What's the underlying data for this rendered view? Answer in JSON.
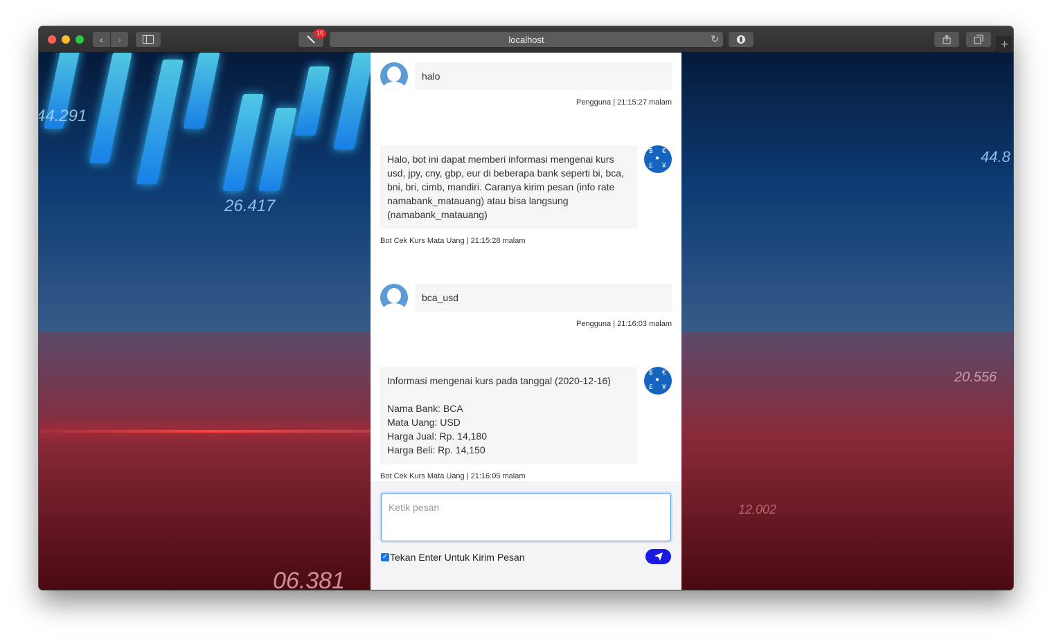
{
  "browser": {
    "address": "localhost",
    "extension_badge": "15",
    "icons": {
      "back": "chevron-left-icon",
      "forward": "chevron-right-icon",
      "sidebar": "sidebar-icon",
      "reload": "reload-icon",
      "share": "share-icon",
      "tabs": "tabs-icon",
      "new_tab": "plus-icon"
    }
  },
  "background": {
    "numbers": [
      "44.291",
      "26.417",
      "06.381",
      "44.8",
      "20.556",
      "12.002"
    ]
  },
  "chat": {
    "messages": [
      {
        "sender": "user",
        "text": "halo",
        "meta": "Pengguna | 21:15:27 malam"
      },
      {
        "sender": "bot",
        "text": "Halo, bot ini dapat memberi informasi mengenai kurs usd, jpy, cny, gbp, eur di beberapa bank seperti bi, bca, bni, bri, cimb, mandiri. Caranya kirim pesan (info rate namabank_matauang) atau bisa langsung (namabank_matauang)",
        "meta": "Bot Cek Kurs Mata Uang | 21:15:28 malam"
      },
      {
        "sender": "user",
        "text": "bca_usd",
        "meta": "Pengguna | 21:16:03 malam"
      },
      {
        "sender": "bot",
        "text": "Informasi mengenai kurs pada tanggal (2020-12-16)\n\nNama Bank: BCA\nMata Uang: USD\nHarga Jual: Rp. 14,180\nHarga Beli: Rp. 14,150",
        "meta": "Bot Cek Kurs Mata Uang | 21:16:05 malam"
      }
    ],
    "composer": {
      "placeholder": "Ketik pesan",
      "enter_to_send_label": "Tekan Enter Untuk Kirim Pesan",
      "enter_to_send_checked": true
    },
    "colors": {
      "send_button": "#1a1ae0",
      "user_avatar": "#5b9bd8",
      "bot_avatar": "#1565c0",
      "bubble": "#f5f4f6"
    }
  }
}
